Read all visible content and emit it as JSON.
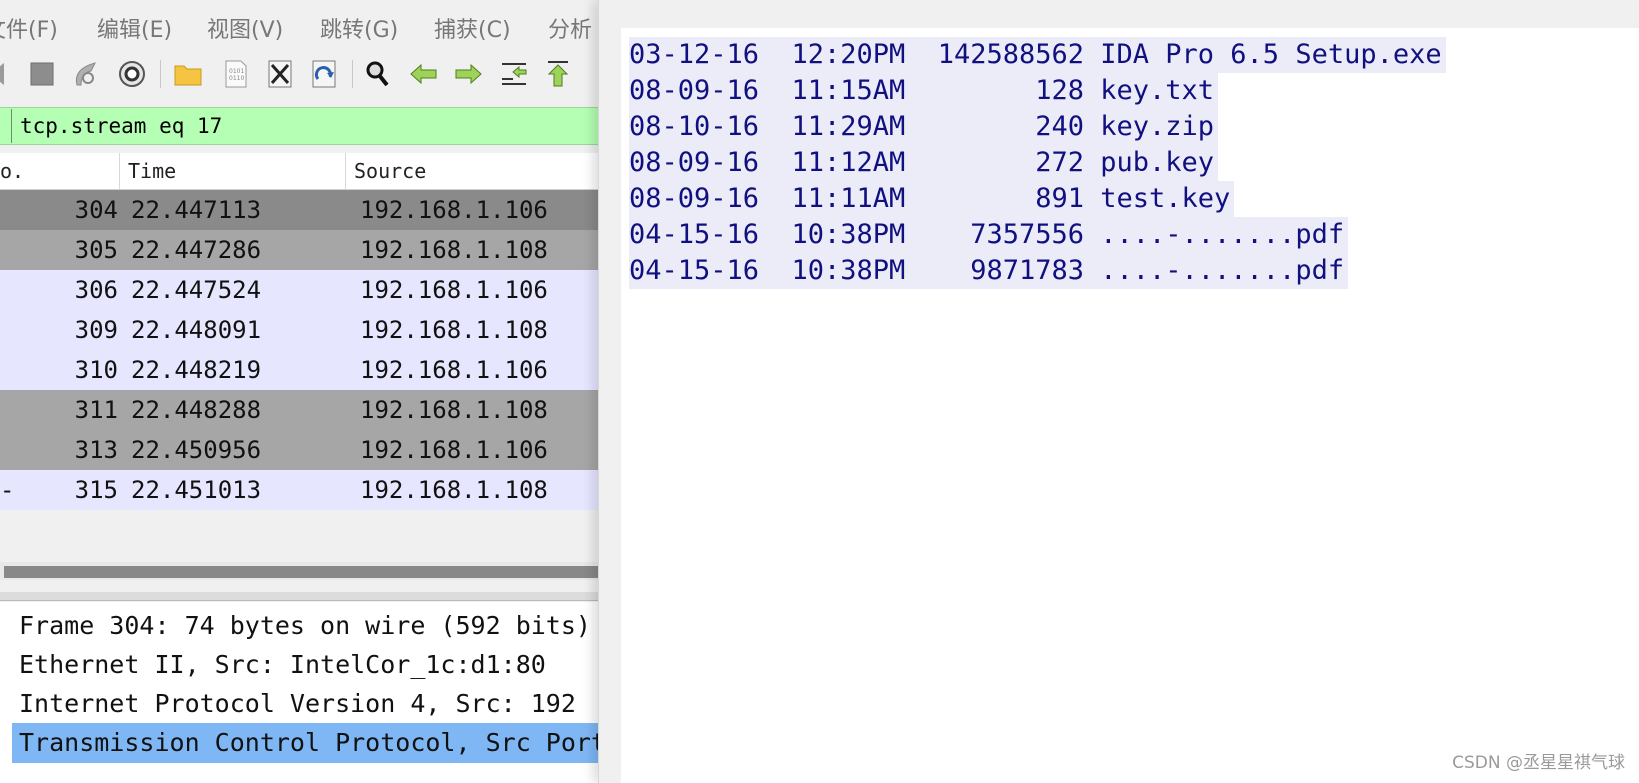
{
  "wireshark": {
    "menu": [
      "文件(F)",
      "编辑(E)",
      "视图(V)",
      "跳转(G)",
      "捕获(C)",
      "分析"
    ],
    "filter": {
      "value": "tcp.stream eq 17"
    },
    "columns": {
      "no": "o.",
      "time": "Time",
      "source": "Source"
    },
    "packets": [
      {
        "no": "304",
        "time": "22.447113",
        "source": "192.168.1.106",
        "mark": "",
        "bg": "#8a8a8a"
      },
      {
        "no": "305",
        "time": "22.447286",
        "source": "192.168.1.108",
        "mark": "",
        "bg": "#a6a6a6"
      },
      {
        "no": "306",
        "time": "22.447524",
        "source": "192.168.1.106",
        "mark": "",
        "bg": "#e7e6ff"
      },
      {
        "no": "309",
        "time": "22.448091",
        "source": "192.168.1.108",
        "mark": "",
        "bg": "#e7e6ff"
      },
      {
        "no": "310",
        "time": "22.448219",
        "source": "192.168.1.106",
        "mark": "",
        "bg": "#e7e6ff"
      },
      {
        "no": "311",
        "time": "22.448288",
        "source": "192.168.1.108",
        "mark": "",
        "bg": "#a6a6a6"
      },
      {
        "no": "313",
        "time": "22.450956",
        "source": "192.168.1.106",
        "mark": "",
        "bg": "#a6a6a6"
      },
      {
        "no": "315",
        "time": "22.451013",
        "source": "192.168.1.108",
        "mark": "-",
        "bg": "#e7e6ff"
      }
    ],
    "details": [
      {
        "text": "Frame 304: 74 bytes on wire (592 bits)",
        "selected": false
      },
      {
        "text": "Ethernet II, Src: IntelCor_1c:d1:80",
        "selected": false
      },
      {
        "text": "Internet Protocol Version 4, Src: 192",
        "selected": false
      },
      {
        "text": "Transmission Control Protocol, Src Port",
        "selected": true
      }
    ],
    "colors": {
      "selected": "#7fb7f5",
      "filter_bg": "#b4ffb4"
    }
  },
  "listing": {
    "rows": [
      {
        "date": "03-12-16",
        "time": "12:20PM",
        "size": "142588562",
        "name": "IDA Pro 6.5 Setup.exe"
      },
      {
        "date": "08-09-16",
        "time": "11:15AM",
        "size": "128",
        "name": "key.txt"
      },
      {
        "date": "08-10-16",
        "time": "11:29AM",
        "size": "240",
        "name": "key.zip"
      },
      {
        "date": "08-09-16",
        "time": "11:12AM",
        "size": "272",
        "name": "pub.key"
      },
      {
        "date": "08-09-16",
        "time": "11:11AM",
        "size": "891",
        "name": "test.key"
      },
      {
        "date": "04-15-16",
        "time": "10:38PM",
        "size": "7357556",
        "name": "....-.......pdf"
      },
      {
        "date": "04-15-16",
        "time": "10:38PM",
        "size": "9871783",
        "name": "....-.......pdf"
      }
    ]
  },
  "watermark": "CSDN @丞星星祺气球"
}
